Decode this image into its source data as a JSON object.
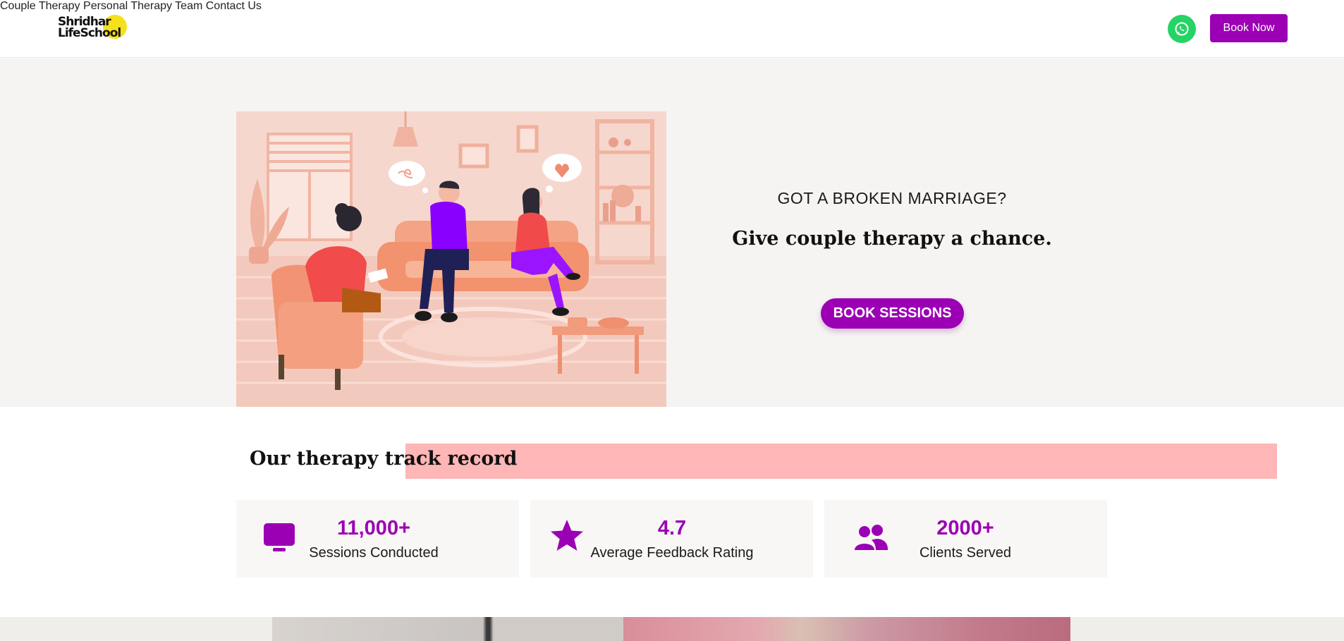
{
  "header": {
    "logo_line1": "Shridhar",
    "logo_line2": "LifeSchool",
    "nav": [
      "Couple Therapy",
      "Personal Therapy",
      "Team",
      "Contact Us"
    ],
    "book_now_label": "Book Now",
    "whatsapp_icon": "whatsapp-icon"
  },
  "hero": {
    "eyebrow": "GOT A BROKEN MARRIAGE?",
    "headline": "Give couple therapy a chance.",
    "cta_label": "BOOK SESSIONS"
  },
  "track": {
    "title": "Our therapy track record",
    "stats": [
      {
        "value": "11,000+",
        "label": "Sessions Conducted",
        "icon": "monitor-icon"
      },
      {
        "value": "4.7",
        "label": "Average Feedback Rating",
        "icon": "star-icon"
      },
      {
        "value": "2000+",
        "label": "Clients Served",
        "icon": "users-icon"
      }
    ]
  },
  "colors": {
    "accent": "#9b00b4",
    "whatsapp": "#25d366",
    "highlight": "#ffb6b6",
    "hero_bg": "#f5f4f2"
  }
}
